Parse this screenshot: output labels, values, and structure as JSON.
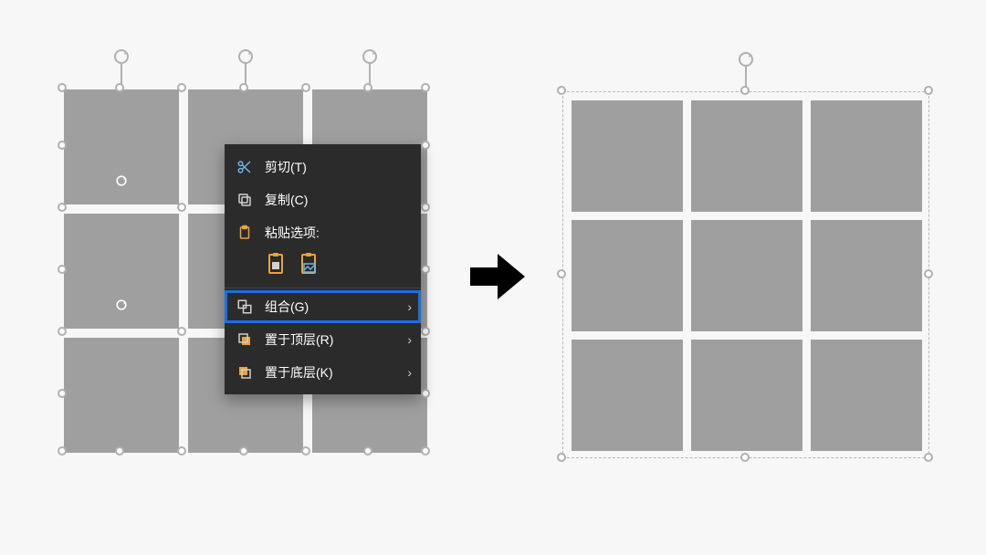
{
  "context_menu": {
    "cut": "剪切(T)",
    "copy": "复制(C)",
    "paste_title": "粘贴选项:",
    "group": "组合(G)",
    "bring_front": "置于顶层(R)",
    "send_back": "置于底层(K)"
  },
  "icons": {
    "cut": "scissors-icon",
    "copy": "copy-icon",
    "paste": "clipboard-icon",
    "group": "group-icon",
    "front": "bring-front-icon",
    "back": "send-back-icon",
    "paste_opt_keep": "paste-keep-icon",
    "paste_opt_picture": "paste-picture-icon",
    "rotate": "rotate-icon",
    "handle": "selection-handle",
    "arrow": "arrow-right-icon"
  },
  "colors": {
    "shape": "#9f9f9f",
    "canvas": "#f7f7f7",
    "menu_bg": "#2b2b2b",
    "highlight": "#1a6fe8",
    "accent": "#e8a33d"
  },
  "grid": {
    "rows": 3,
    "cols": 3
  },
  "chart_data": null
}
